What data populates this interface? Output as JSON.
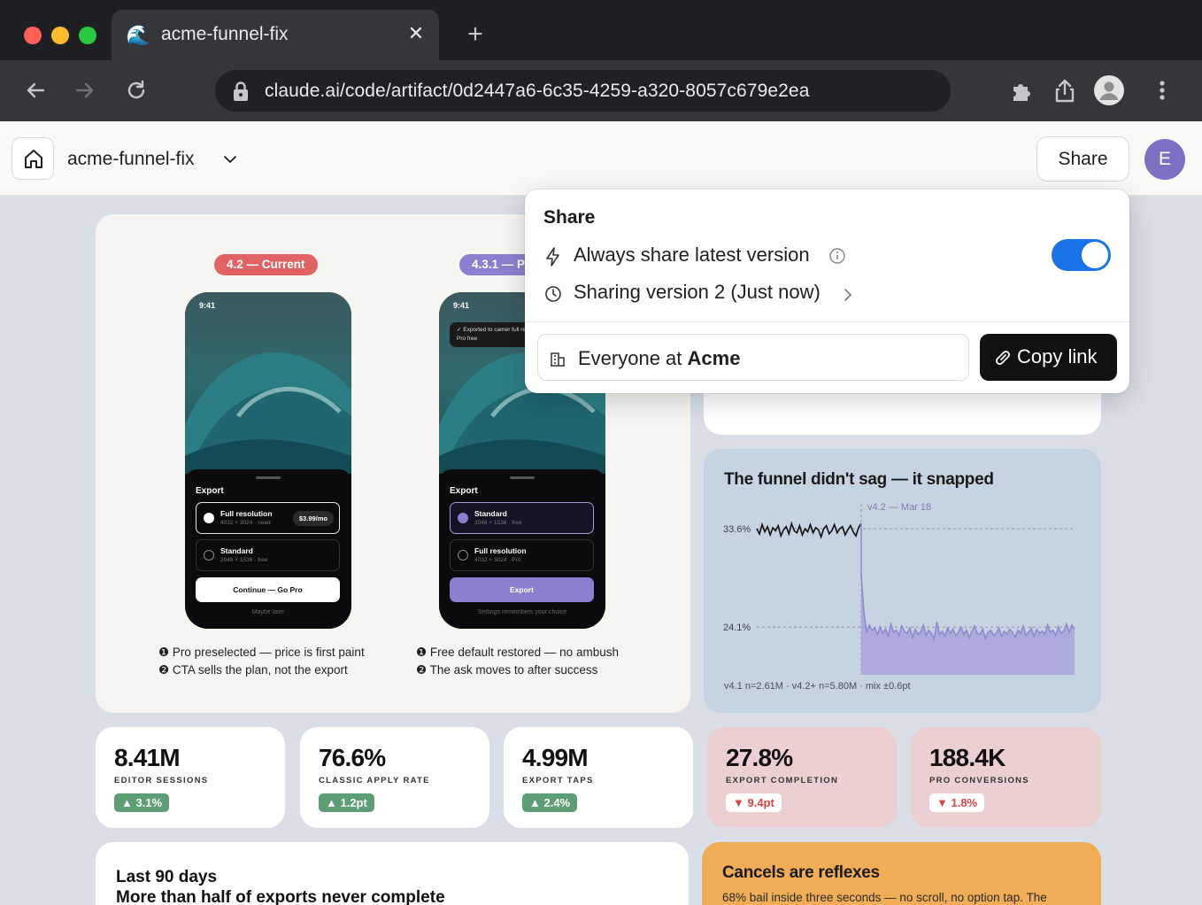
{
  "browser": {
    "tab_title": "acme-funnel-fix",
    "tab_favicon": "🌊",
    "url": "claude.ai/code/artifact/0d2447a6-6c35-4259-a320-8057c679e2ea"
  },
  "app": {
    "title": "acme-funnel-fix",
    "share_label": "Share",
    "avatar_initial": "E"
  },
  "compare": {
    "left": {
      "pill": "4.2 — Current",
      "pill_color": "#e06262",
      "time": "9:41",
      "sheet_title": "Export",
      "option1_label": "Full resolution",
      "option1_sub": "4032 × 3024 · need",
      "option1_price": "$3.99/mo",
      "option2_label": "Standard",
      "option2_sub": "2048 × 1536 · free",
      "cta": "Continue — Go Pro",
      "cta_sub": "Maybe later",
      "note1": "❶ Pro preselected — price is first paint",
      "note2": "❷ CTA sells the plan, not the export"
    },
    "right": {
      "pill": "4.3.1 — P",
      "pill_color": "#8b80d0",
      "time": "9:41",
      "toast": "✓ Exported to camer full res? Try Pro free",
      "sheet_title": "Export",
      "option1_label": "Standard",
      "option1_sub": "2048 × 1536 · free",
      "option2_label": "Full resolution",
      "option2_sub": "4032 × 3024 · Pro",
      "cta": "Export",
      "cta_sub": "Settings remembers your choice",
      "note1": "❶ Free default restored — no ambush",
      "note2": "❷ The ask moves to after success"
    }
  },
  "chart_card": {
    "title": "The funnel didn't sag — it snapped",
    "footnote": "v4.1 n=2.61M · v4.2+ n=5.80M · mix ±0.6pt"
  },
  "chart_data": {
    "type": "line",
    "title": "The funnel didn't sag — it snapped",
    "annotation": "v4.2 — Mar 18",
    "y_ticks": [
      "33.6%",
      "24.1%"
    ],
    "y_tick_values": [
      33.6,
      24.1
    ],
    "ylim": [
      19.5,
      36
    ],
    "series": [
      {
        "segment": "before",
        "values": [
          33.6,
          33.1,
          34.0,
          33.3,
          33.8,
          33.0,
          33.7,
          33.4,
          33.9,
          32.9,
          33.5,
          33.8,
          33.1,
          34.1,
          33.4,
          33.2,
          33.9,
          33.0,
          33.6,
          33.3,
          34.0,
          33.2,
          33.7,
          33.5,
          32.8,
          33.6,
          33.9,
          33.1,
          33.4,
          34.0,
          33.2,
          33.6,
          33.8,
          33.0,
          33.5,
          33.9,
          33.3,
          32.9,
          33.7,
          34.1
        ]
      },
      {
        "segment": "after",
        "values": [
          29.0,
          25.5,
          23.6,
          24.3,
          23.8,
          24.0,
          23.4,
          24.1,
          23.5,
          23.9,
          23.2,
          24.4,
          23.6,
          23.8,
          23.3,
          24.2,
          23.7,
          23.5,
          24.0,
          23.1,
          23.9,
          23.4,
          23.6,
          24.3,
          23.3,
          23.8,
          23.5,
          22.9,
          24.6,
          23.4,
          23.7,
          23.2,
          24.0,
          23.5,
          23.9,
          23.3,
          23.6,
          24.1,
          23.4,
          23.8,
          23.1,
          23.7,
          24.2,
          23.5,
          23.4,
          23.9,
          23.0,
          23.6,
          23.8,
          23.3,
          23.5,
          24.0,
          23.2,
          23.7,
          23.4,
          23.9,
          23.6,
          23.1,
          23.8,
          23.5,
          24.2,
          23.3,
          23.6,
          24.0,
          23.2,
          23.9,
          23.5,
          23.7,
          23.4,
          24.3,
          23.6,
          23.8,
          23.3,
          24.1,
          23.5,
          23.7,
          24.4,
          23.6,
          24.3,
          23.9
        ]
      }
    ],
    "colors": {
      "before": "#111111",
      "after": "#8f8ad0",
      "after_fill": "#a7a3db"
    }
  },
  "kpis": [
    {
      "value": "8.41M",
      "label": "EDITOR SESSIONS",
      "delta": "3.1%",
      "dir": "up"
    },
    {
      "value": "76.6%",
      "label": "CLASSIC APPLY RATE",
      "delta": "1.2pt",
      "dir": "up"
    },
    {
      "value": "4.99M",
      "label": "EXPORT TAPS",
      "delta": "2.4%",
      "dir": "up"
    },
    {
      "value": "27.8%",
      "label": "EXPORT COMPLETION",
      "delta": "9.4pt",
      "dir": "down"
    },
    {
      "value": "188.4K",
      "label": "PRO CONVERSIONS",
      "delta": "1.8%",
      "dir": "down"
    }
  ],
  "bottom_left": {
    "line1": "Last 90 days",
    "line2": "More than half of exports never complete"
  },
  "bottom_right": {
    "title": "Cancels are reflexes",
    "text": "68% bail inside three seconds — no scroll, no option tap. The"
  },
  "share_popover": {
    "title": "Share",
    "always_latest_label": "Always share latest version",
    "always_latest_on": true,
    "version_label": "Sharing version 2 (Just now)",
    "audience_prefix": "Everyone at ",
    "audience_org": "Acme",
    "copy_label": "Copy link"
  }
}
